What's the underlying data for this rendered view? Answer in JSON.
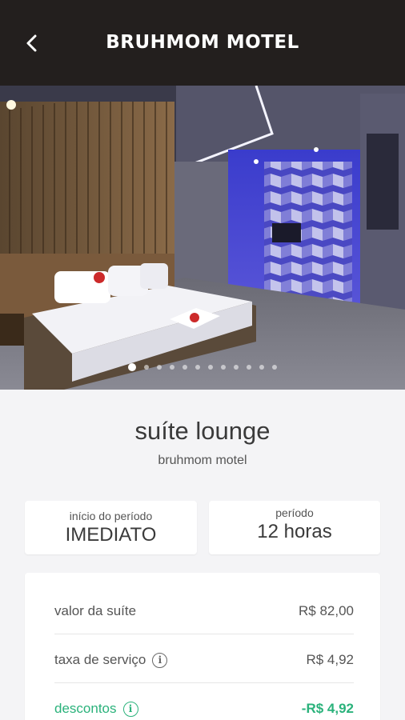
{
  "header": {
    "title": "BRUHMOM MOTEL",
    "back_icon": "chevron-left-icon"
  },
  "gallery": {
    "total_images": 12,
    "active_index": 0
  },
  "suite": {
    "name": "suíte lounge",
    "motel": "bruhmom motel"
  },
  "period_start": {
    "label": "início do período",
    "value": "IMEDIATO"
  },
  "period": {
    "label": "período",
    "value": "12 horas"
  },
  "pricing": {
    "rows": [
      {
        "label": "valor da suíte",
        "value": "R$ 82,00"
      },
      {
        "label": "taxa de serviço",
        "value": "R$ 4,92"
      },
      {
        "label": "descontos",
        "value": "-R$ 4,92"
      }
    ]
  },
  "colors": {
    "header_bg": "#231f1e",
    "discount_green": "#2ab27b",
    "page_bg": "#f4f4f6"
  }
}
